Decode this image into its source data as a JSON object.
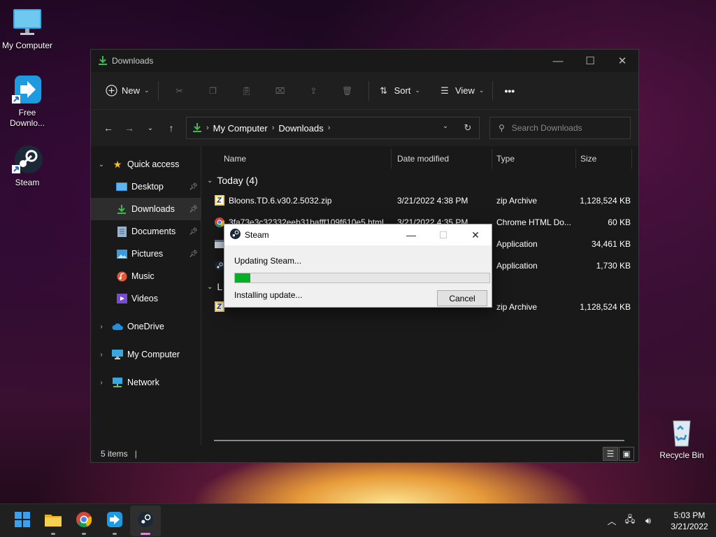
{
  "desktop": {
    "icons": [
      {
        "label": "My Computer"
      },
      {
        "label": "Free Downlo..."
      },
      {
        "label": "Steam"
      },
      {
        "label": "Recycle Bin"
      }
    ]
  },
  "explorer": {
    "title": "Downloads",
    "toolbar": {
      "new_label": "New",
      "sort_label": "Sort",
      "view_label": "View",
      "more_label": "•••"
    },
    "address": {
      "crumbs": [
        "My Computer",
        "Downloads"
      ]
    },
    "search": {
      "placeholder": "Search Downloads"
    },
    "nav": {
      "quick_access": "Quick access",
      "items": [
        "Desktop",
        "Downloads",
        "Documents",
        "Pictures",
        "Music",
        "Videos"
      ],
      "onedrive": "OneDrive",
      "my_computer": "My Computer",
      "network": "Network"
    },
    "columns": [
      "Name",
      "Date modified",
      "Type",
      "Size"
    ],
    "groups": {
      "today": "Today (4)",
      "last": "L"
    },
    "rows": [
      {
        "name": "Bloons.TD.6.v30.2.5032.zip",
        "date": "3/21/2022 4:38 PM",
        "type": "zip Archive",
        "size": "1,128,524 KB"
      },
      {
        "name": "3fa73e3c32332eeb31bafff109f610e5.html",
        "date": "3/21/2022 4:35 PM",
        "type": "Chrome HTML Do...",
        "size": "60 KB"
      },
      {
        "name": "",
        "date": "",
        "type": "Application",
        "size": "34,461 KB"
      },
      {
        "name": "",
        "date": "",
        "type": "Application",
        "size": "1,730 KB"
      },
      {
        "name": "",
        "date": "",
        "type": "zip Archive",
        "size": "1,128,524 KB"
      }
    ],
    "status": {
      "items": "5 items",
      "cursor": "|"
    }
  },
  "dialog": {
    "title": "Steam",
    "status": "Updating Steam...",
    "progress": 0.06,
    "substatus": "Installing update...",
    "cancel_label": "Cancel"
  },
  "taskbar": {
    "time": "5:03 PM",
    "date": "3/21/2022"
  },
  "colors": {
    "progress_fill": "#06b025",
    "folder_accent": "#f4c430",
    "downloads_green": "#3fb950",
    "steam_active": "#e08bd0"
  }
}
